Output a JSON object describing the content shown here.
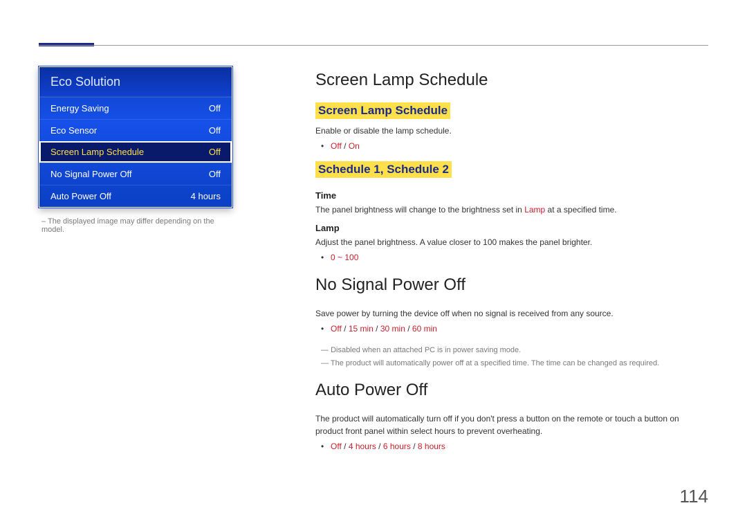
{
  "panel": {
    "title": "Eco Solution",
    "rows": [
      {
        "label": "Energy Saving",
        "value": "Off",
        "selected": false
      },
      {
        "label": "Eco Sensor",
        "value": "Off",
        "selected": false
      },
      {
        "label": "Screen Lamp Schedule",
        "value": "Off",
        "selected": true
      },
      {
        "label": "No Signal Power Off",
        "value": "Off",
        "selected": false
      },
      {
        "label": "Auto Power Off",
        "value": "4 hours",
        "selected": false
      }
    ]
  },
  "left_note": "The displayed image may differ depending on the model.",
  "s1": {
    "h1": "Screen Lamp Schedule",
    "sub1": "Screen Lamp Schedule",
    "sub1_desc": "Enable or disable the lamp schedule.",
    "sub1_opts": [
      "Off",
      "On"
    ],
    "sub2": "Schedule 1, Schedule 2",
    "time_label": "Time",
    "time_desc_pre": "The panel brightness will change to the brightness set in ",
    "time_desc_mid": "Lamp",
    "time_desc_post": " at a specified time.",
    "lamp_label": "Lamp",
    "lamp_desc": "Adjust the panel brightness. A value closer to 100 makes the panel brighter.",
    "lamp_range": "0 ~ 100"
  },
  "s2": {
    "h1": "No Signal Power Off",
    "desc": "Save power by turning the device off when no signal is received from any source.",
    "opts": [
      "Off",
      "15 min",
      "30 min",
      "60 min"
    ],
    "note1": "Disabled when an attached PC is in power saving mode.",
    "note2": "The product will automatically power off at a specified time. The time can be changed as required."
  },
  "s3": {
    "h1": "Auto Power Off",
    "desc": "The product will automatically turn off if you don't press a button on the remote or touch a button on product front panel within select hours to prevent overheating.",
    "opts": [
      "Off",
      "4 hours",
      "6 hours",
      "8 hours"
    ]
  },
  "page_number": "114"
}
